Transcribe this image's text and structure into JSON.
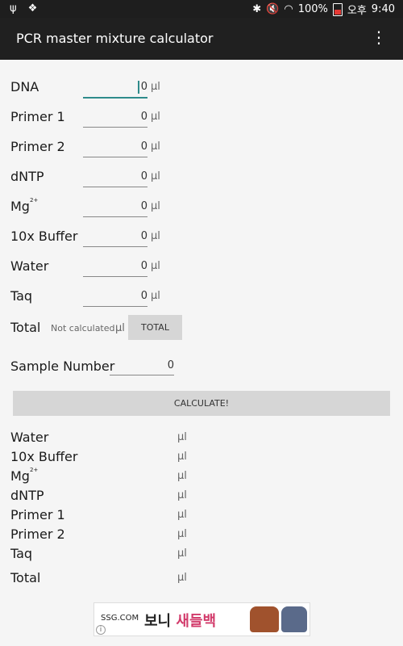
{
  "status": {
    "battery_percent": "100%",
    "ampm": "오후",
    "time": "9:40"
  },
  "app": {
    "title": "PCR master mixture calculator"
  },
  "inputs": [
    {
      "label": "DNA",
      "value": "0",
      "unit": "μl"
    },
    {
      "label": "Primer 1",
      "value": "0",
      "unit": "μl"
    },
    {
      "label": "Primer 2",
      "value": "0",
      "unit": "μl"
    },
    {
      "label": "dNTP",
      "value": "0",
      "unit": "μl"
    },
    {
      "label": "Mg",
      "sup": "2+",
      "value": "0",
      "unit": "μl"
    },
    {
      "label": "10x Buffer",
      "value": "0",
      "unit": "μl"
    },
    {
      "label": "Water",
      "value": "0",
      "unit": "μl"
    },
    {
      "label": "Taq",
      "value": "0",
      "unit": "μl"
    }
  ],
  "total": {
    "label": "Total",
    "value": "Not calculated",
    "unit": "μl",
    "button": "TOTAL"
  },
  "sample": {
    "label": "Sample Number",
    "value": "0"
  },
  "calculate_button": "CALCULATE!",
  "results": [
    {
      "label": "Water",
      "unit": "μl"
    },
    {
      "label": "10x Buffer",
      "unit": "μl"
    },
    {
      "label": "Mg",
      "sup": "2+",
      "unit": "μl"
    },
    {
      "label": "dNTP",
      "unit": "μl"
    },
    {
      "label": "Primer 1",
      "unit": "μl"
    },
    {
      "label": "Primer 2",
      "unit": "μl"
    },
    {
      "label": "Taq",
      "unit": "μl"
    }
  ],
  "results_total": {
    "label": "Total",
    "unit": "μl"
  },
  "ad": {
    "brand": "SSG.COM",
    "text_1": "보니",
    "text_2": "새들백"
  }
}
